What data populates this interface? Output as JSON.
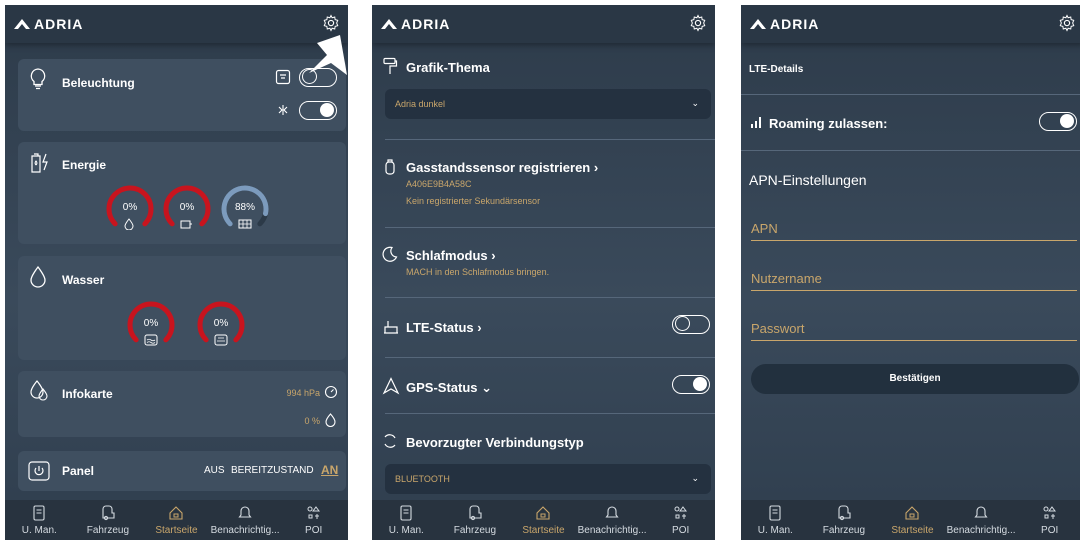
{
  "brand": "ADRIA",
  "nav": [
    {
      "label": "U. Man.",
      "icon": "manual-icon"
    },
    {
      "label": "Fahrzeug",
      "icon": "vehicle-icon"
    },
    {
      "label": "Startseite",
      "icon": "home-icon",
      "active": true
    },
    {
      "label": "Benachrichtig...",
      "icon": "notification-icon"
    },
    {
      "label": "POI",
      "icon": "poi-icon"
    }
  ],
  "panel1": {
    "lighting": {
      "title": "Beleuchtung",
      "toggles": [
        {
          "state": "off"
        },
        {
          "state": "on"
        }
      ]
    },
    "energy": {
      "title": "Energie",
      "gauges": [
        {
          "value": "0%",
          "level": 0,
          "icon": "gas-icon"
        },
        {
          "value": "0%",
          "level": 0,
          "icon": "battery-icon"
        },
        {
          "value": "88%",
          "level": 0.88,
          "icon": "solar-icon"
        }
      ]
    },
    "water": {
      "title": "Wasser",
      "gauges": [
        {
          "value": "0%",
          "level": 0,
          "icon": "freshwater-tank-icon"
        },
        {
          "value": "0%",
          "level": 0,
          "icon": "wastewater-tank-icon"
        }
      ]
    },
    "info": {
      "title": "Infokarte",
      "pressure": "994 hPa",
      "humidity": "0 %"
    },
    "panel": {
      "title": "Panel",
      "off": "AUS",
      "standby": "BEREITZUSTAND",
      "on": "AN"
    }
  },
  "panel2": {
    "theme": {
      "title": "Grafik-Thema",
      "selected": "Adria dunkel"
    },
    "gas_sensor": {
      "title": "Gasstandssensor registrieren",
      "id": "A406E9B4A58C",
      "note": "Kein registrierter Sekundärsensor"
    },
    "sleep": {
      "title": "Schlafmodus",
      "note": "MACH in den Schlafmodus bringen."
    },
    "lte": {
      "title": "LTE-Status",
      "toggle": "off"
    },
    "gps": {
      "title": "GPS-Status",
      "toggle": "on"
    },
    "connection": {
      "title": "Bevorzugter Verbindungstyp",
      "selected": "BLUETOOTH"
    }
  },
  "panel3": {
    "header": "LTE-Details",
    "roaming": {
      "label": "Roaming zulassen:",
      "toggle": "on"
    },
    "apn_section": "APN-Einstellungen",
    "fields": {
      "apn": "APN",
      "user": "Nutzername",
      "password": "Passwort"
    },
    "confirm": "Bestätigen"
  },
  "colors": {
    "accent": "#c9a66b",
    "gauge_red": "#c8141e",
    "gauge_blue": "#7c9bbd",
    "gauge_track": "#2c3a48"
  }
}
